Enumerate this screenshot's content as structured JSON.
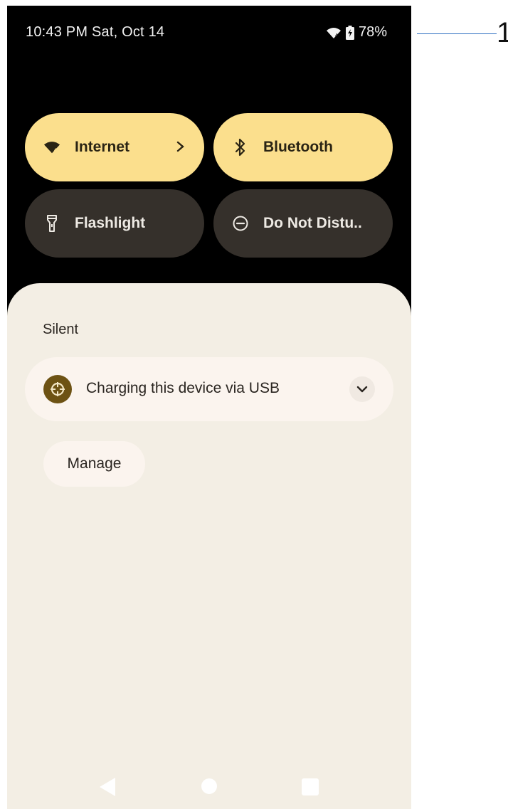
{
  "status_bar": {
    "time_date": "10:43 PM Sat, Oct 14",
    "battery_percent": "78%",
    "wifi_icon": "wifi-icon",
    "battery_icon": "battery-charging-icon"
  },
  "quick_tiles": [
    {
      "label": "Internet",
      "icon": "wifi-icon",
      "state": "on",
      "has_chevron": true
    },
    {
      "label": "Bluetooth",
      "icon": "bluetooth-icon",
      "state": "on"
    },
    {
      "label": "Flashlight",
      "icon": "flashlight-icon",
      "state": "off"
    },
    {
      "label": "Do Not Distu..",
      "icon": "do-not-disturb-icon",
      "state": "off"
    }
  ],
  "notifications": {
    "section_label": "Silent",
    "items": [
      {
        "title": "Charging this device via USB",
        "icon": "android-system-icon"
      }
    ],
    "manage_label": "Manage"
  },
  "nav_bar": {
    "back_icon": "back-icon",
    "home_icon": "home-icon",
    "recents_icon": "recents-icon"
  },
  "callout": {
    "number": "1"
  },
  "colors": {
    "tile_on": "#fbdf8d",
    "tile_off": "#35302b",
    "shade_bg": "#f3eee4",
    "card_bg": "#fbf4ee",
    "app_icon": "#6d5213",
    "callout_line": "#2d6ec2"
  }
}
